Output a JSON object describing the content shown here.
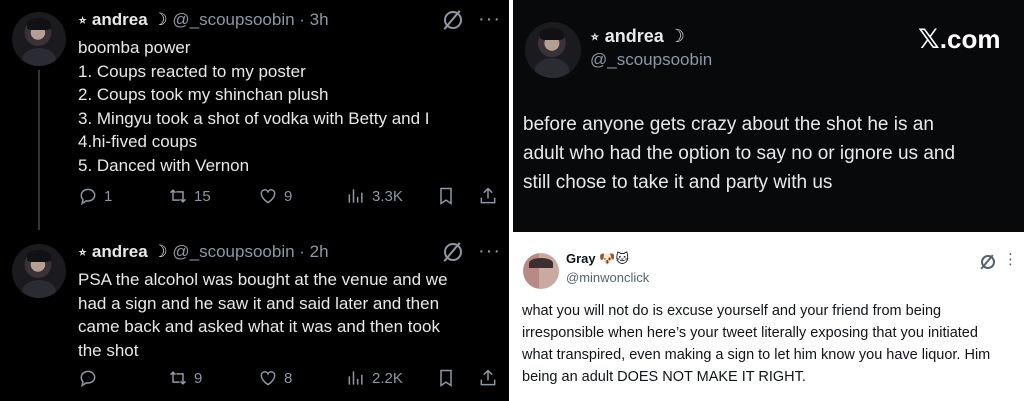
{
  "thread": {
    "tweets": [
      {
        "name": "andrea",
        "prefix_symbol": "⭒",
        "suffix_symbol": "☽",
        "handle": "@_scoupsoobin",
        "time": "3h",
        "lines": [
          "boomba power",
          "1. Coups reacted to my poster",
          "2. Coups took my shinchan plush",
          "3. Mingyu took a shot of vodka with Betty and I",
          "4.hi-fived coups",
          "5. Danced with Vernon"
        ],
        "replies": "1",
        "reposts": "15",
        "likes": "9",
        "views": "3.3K"
      },
      {
        "name": "andrea",
        "prefix_symbol": "⭒",
        "suffix_symbol": "☽",
        "handle": "@_scoupsoobin",
        "time": "2h",
        "lines": [
          "PSA the alcohol was bought at the venue and we",
          "had a sign and he saw it and said later and then",
          "came back and asked what it was and then took",
          "the shot"
        ],
        "replies": "",
        "reposts": "9",
        "likes": "8",
        "views": "2.2K"
      }
    ]
  },
  "screenshot_post": {
    "name": "andrea",
    "prefix_symbol": "⭒",
    "suffix_symbol": "☽",
    "handle": "@_scoupsoobin",
    "brand_x": "𝕏",
    "brand_suffix": ".com",
    "lines": [
      "before anyone gets crazy about the shot he is an",
      "adult who had the option to say no or ignore us and",
      "still chose to take it and party with us"
    ]
  },
  "reply_post": {
    "name": "Gray",
    "name_emoji": "🐶🐱",
    "handle": "@minwonclick",
    "lines": [
      "what you will not do is excuse yourself and your friend from being",
      "irresponsible when here’s your tweet literally exposing that you initiated",
      "what transpired, even making a sign to let him know you have liquor. Him",
      "being an adult DOES NOT MAKE IT RIGHT."
    ]
  },
  "icons": {
    "reply": "reply-icon",
    "repost": "repost-icon",
    "like": "heart-icon",
    "views": "views-icon",
    "bookmark": "bookmark-icon",
    "share": "share-icon",
    "grok": "grok-icon",
    "more": "more-icon"
  },
  "colors": {
    "dark_bg": "#000000",
    "dark_text": "#e7e9ea",
    "dark_muted": "#8b98a5",
    "light_bg": "#ffffff",
    "light_text": "#0f1419",
    "light_muted": "#536471"
  }
}
